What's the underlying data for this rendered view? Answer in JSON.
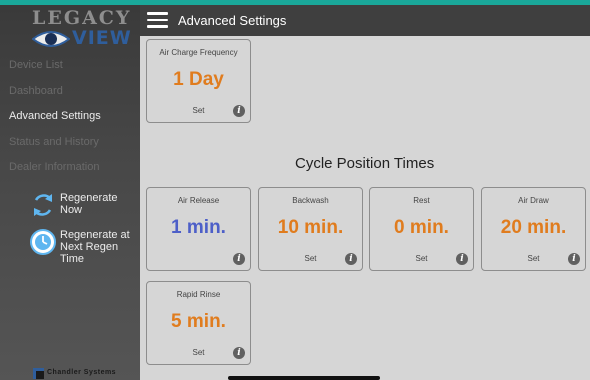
{
  "logo": {
    "top": "LEGACY",
    "bottom": "VIEW"
  },
  "header": {
    "title": "Advanced Settings",
    "menu_icon": "hamburger-menu-icon"
  },
  "sidebar": {
    "items": [
      {
        "label": "Device List",
        "active": false
      },
      {
        "label": "Dashboard",
        "active": false
      },
      {
        "label": "Advanced Settings",
        "active": true
      },
      {
        "label": "Status and History",
        "active": false
      },
      {
        "label": "Dealer Information",
        "active": false
      }
    ],
    "actions": [
      {
        "label": "Regenerate\nNow",
        "icon": "regenerate-now-icon"
      },
      {
        "label": "Regenerate at\nNext Regen Time",
        "icon": "regenerate-later-clock-icon"
      }
    ],
    "brand": "Chandler Systems"
  },
  "air_charge": {
    "title": "Air Charge Frequency",
    "value": "1 Day",
    "set_label": "Set"
  },
  "cycle_section_title": "Cycle Position Times",
  "cycles": [
    {
      "title": "Air Release",
      "value": "1 min.",
      "set_label": "",
      "color": "#4d5fc8"
    },
    {
      "title": "Backwash",
      "value": "10 min.",
      "set_label": "Set",
      "color": "#e07c1e"
    },
    {
      "title": "Rest",
      "value": "0 min.",
      "set_label": "Set",
      "color": "#e07c1e"
    },
    {
      "title": "Air Draw",
      "value": "20 min.",
      "set_label": "Set",
      "color": "#e07c1e"
    },
    {
      "title": "Rapid Rinse",
      "value": "5 min.",
      "set_label": "Set",
      "color": "#e07c1e"
    }
  ],
  "colors": {
    "accent_orange": "#e07c1e",
    "accent_blue": "#4d5fc8",
    "sidebar_bg": "#474747",
    "content_bg": "#d6d6d6"
  }
}
